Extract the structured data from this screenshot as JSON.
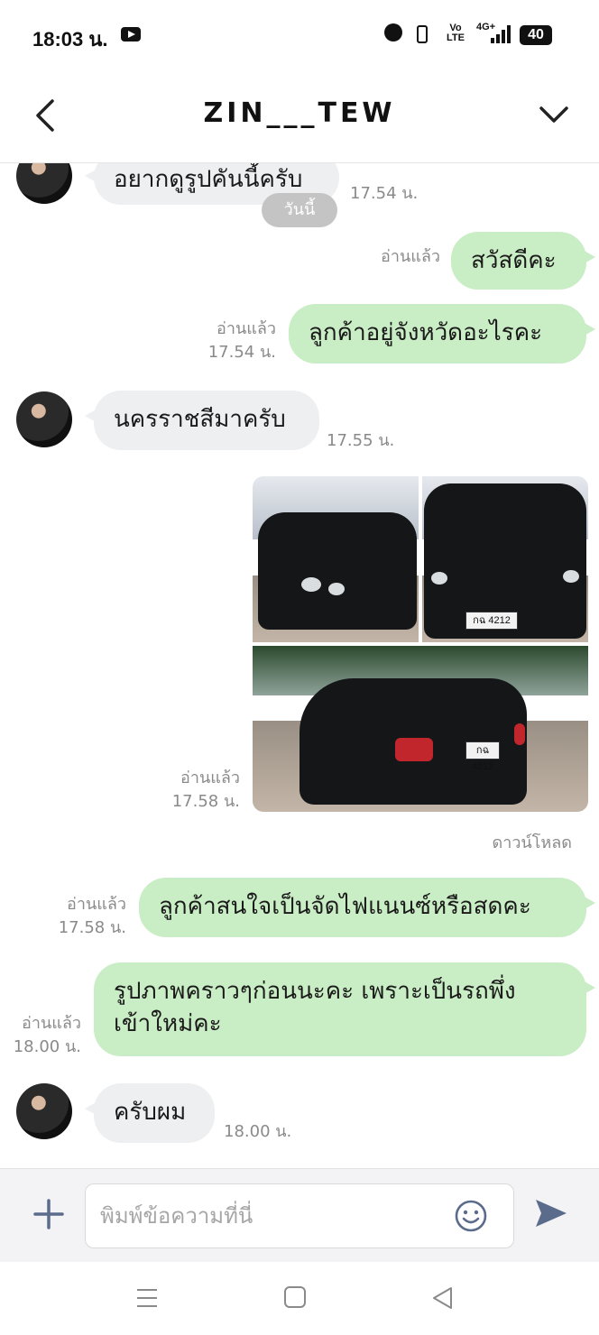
{
  "status_bar": {
    "time": "18:03 น.",
    "network_type": "4G+",
    "volte": "Vo LTE",
    "battery": "40"
  },
  "header": {
    "title": "ZIN___TEW"
  },
  "chat": {
    "date_separator": "วันนี้",
    "messages": [
      {
        "side": "in",
        "text": "อยากดูรูปคันนี้ครับ",
        "time": "17.54 น."
      },
      {
        "side": "out",
        "text": "สวัสดีคะ",
        "read": "อ่านแล้ว",
        "time": ""
      },
      {
        "side": "out",
        "text": "ลูกค้าอยู่จังหวัดอะไรคะ",
        "read": "อ่านแล้ว",
        "time": "17.54 น."
      },
      {
        "side": "in",
        "text": "นครราชสีมาครับ",
        "time": "17.55 น."
      },
      {
        "side": "out",
        "type": "photos",
        "read": "อ่านแล้ว",
        "time": "17.58 น.",
        "plate": "กฉ 4212",
        "download_label": "ดาวน์โหลด"
      },
      {
        "side": "out",
        "text": "ลูกค้าสนใจเป็นจัดไฟแนนซ์หรือสดคะ",
        "read": "อ่านแล้ว",
        "time": "17.58 น."
      },
      {
        "side": "out",
        "text_line1": "รูปภาพคราวๆก่อนนะคะ เพราะเป็นรถพึ่ง",
        "text_line2": "เข้าใหม่คะ",
        "read": "อ่านแล้ว",
        "time": "18.00 น."
      },
      {
        "side": "in",
        "text": "ครับผม",
        "time": "18.00 น."
      }
    ]
  },
  "input": {
    "placeholder": "พิมพ์ข้อความที่นี่"
  },
  "colors": {
    "outgoing_bubble": "#c9edc4",
    "incoming_bubble": "#eeeff1",
    "accent": "#5a6b8c"
  }
}
